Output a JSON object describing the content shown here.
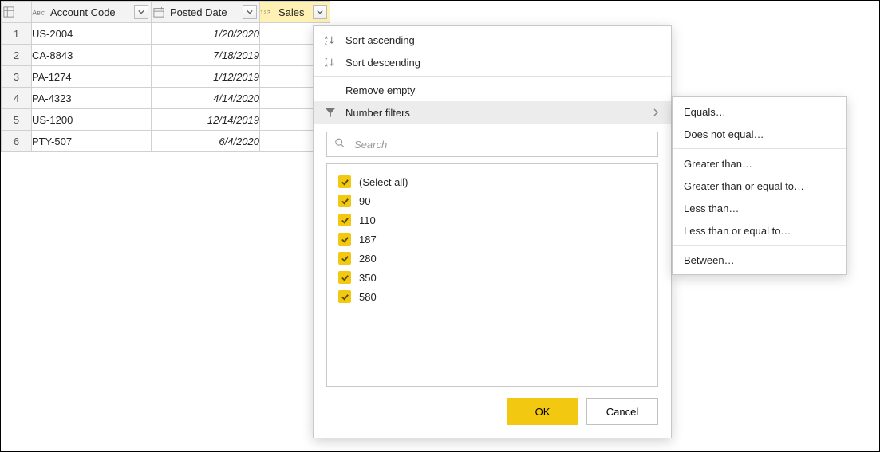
{
  "columns": {
    "row_corner_icon": "table-icon",
    "account": {
      "label": "Account Code",
      "type_icon": "text-type-icon"
    },
    "posted": {
      "label": "Posted Date",
      "type_icon": "date-type-icon"
    },
    "sales": {
      "label": "Sales",
      "type_icon": "number-type-icon"
    }
  },
  "rows": [
    {
      "n": "1",
      "account": "US-2004",
      "posted": "1/20/2020"
    },
    {
      "n": "2",
      "account": "CA-8843",
      "posted": "7/18/2019"
    },
    {
      "n": "3",
      "account": "PA-1274",
      "posted": "1/12/2019"
    },
    {
      "n": "4",
      "account": "PA-4323",
      "posted": "4/14/2020"
    },
    {
      "n": "5",
      "account": "US-1200",
      "posted": "12/14/2019"
    },
    {
      "n": "6",
      "account": "PTY-507",
      "posted": "6/4/2020"
    }
  ],
  "menu": {
    "sort_asc": "Sort ascending",
    "sort_desc": "Sort descending",
    "remove_empty": "Remove empty",
    "number_filters": "Number filters",
    "search_placeholder": "Search",
    "select_all": "(Select all)",
    "values": [
      "90",
      "110",
      "187",
      "280",
      "350",
      "580"
    ],
    "ok": "OK",
    "cancel": "Cancel"
  },
  "submenu": {
    "equals": "Equals…",
    "does_not_equal": "Does not equal…",
    "greater_than": "Greater than…",
    "gte": "Greater than or equal to…",
    "less_than": "Less than…",
    "lte": "Less than or equal to…",
    "between": "Between…"
  }
}
